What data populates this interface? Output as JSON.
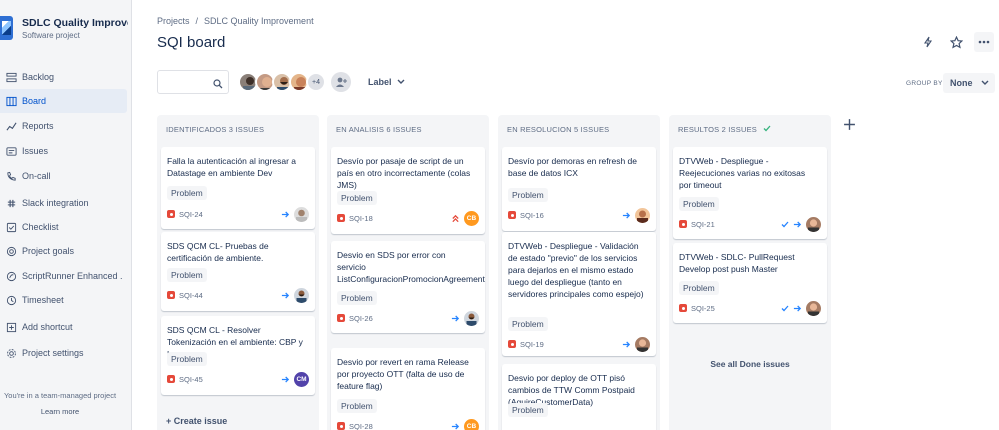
{
  "project": {
    "name": "SDLC Quality Improvem...",
    "type": "Software project"
  },
  "sidebar": {
    "items": [
      {
        "label": "Backlog",
        "icon": "backlog-icon"
      },
      {
        "label": "Board",
        "icon": "board-icon",
        "active": true
      },
      {
        "label": "Reports",
        "icon": "reports-icon"
      },
      {
        "label": "Issues",
        "icon": "issues-icon"
      },
      {
        "label": "On-call",
        "icon": "on-call-icon"
      },
      {
        "label": "Slack integration",
        "icon": "slack-icon"
      },
      {
        "label": "Checklist",
        "icon": "checklist-icon"
      },
      {
        "label": "Project goals",
        "icon": "goals-icon"
      },
      {
        "label": "ScriptRunner Enhanced ...",
        "icon": "scriptrunner-icon"
      },
      {
        "label": "Timesheet",
        "icon": "timesheet-icon"
      },
      {
        "label": "Add shortcut",
        "icon": "add-shortcut-icon"
      },
      {
        "label": "Project settings",
        "icon": "settings-icon"
      }
    ],
    "team_note": "You're in a team-managed project",
    "learn_more": "Learn more"
  },
  "breadcrumb": {
    "projects": "Projects",
    "sep": "/",
    "project": "SDLC Quality Improvement"
  },
  "page_title": "SQI board",
  "toolbar": {
    "avatar_overflow": "+4",
    "label_filter": "Label",
    "group_by": "GROUP BY",
    "group_value": "None"
  },
  "columns": [
    {
      "title": "IDENTIFICADOS 3 ISSUES",
      "create_issue": "+ Create issue",
      "cards": [
        {
          "title": "Falla la autenticación al ingresar a Datastage en ambiente Dev",
          "label": "Problem",
          "key": "SQI-24",
          "priority": "medium",
          "assignee": "gray"
        },
        {
          "title": "SDS QCM CL- Pruebas de certificación de ambiente.",
          "label": "Problem",
          "key": "SQI-44",
          "priority": "medium",
          "assignee": "beard"
        },
        {
          "title": "SDS QCM CL - Resolver Tokenización en el ambiente: CBP y Lyra",
          "label": "Problem",
          "key": "SQI-45",
          "priority": "medium",
          "assignee": "CM"
        }
      ]
    },
    {
      "title": "EN ANALISIS 6 ISSUES",
      "cards": [
        {
          "title": "Desvío por pasaje de script de un país en otro incorrectamente (colas JMS)",
          "label": "Problem",
          "key": "SQI-18",
          "priority": "highest",
          "assignee": "CB"
        },
        {
          "title": "Desvio en SDS por error con servicio ListConfiguracionPromocionAgreement",
          "label": "Problem",
          "key": "SQI-26",
          "priority": "medium",
          "assignee": "beard"
        },
        {
          "title": "Desvio por revert en rama Release por proyecto OTT (falta de uso de feature flag)",
          "label": "Problem",
          "key": "SQI-28",
          "priority": "medium",
          "assignee": "CB"
        }
      ]
    },
    {
      "title": "EN RESOLUCION 5 ISSUES",
      "cards": [
        {
          "title": "Desvío por demoras en refresh de base de datos ICX",
          "label": "Problem",
          "key": "SQI-16",
          "priority": "medium",
          "assignee": "orange"
        },
        {
          "title": "DTVWeb - Despliegue - Validación de estado \"previo\" de los servicios para dejarlos en el mismo estado luego del despliegue (tanto en servidores principales como espejo)",
          "label": "Problem",
          "key": "SQI-19",
          "priority": "medium",
          "assignee": "man"
        },
        {
          "title": "Desvio por deploy de OTT pisó cambios de TTW Comm Postpaid (AquireCustomerData)",
          "label": "Problem",
          "key": "",
          "priority": "",
          "assignee": ""
        }
      ]
    },
    {
      "title": "RESULTOS 2 ISSUES",
      "done": true,
      "see_all": "See all Done issues",
      "cards": [
        {
          "title": "DTVWeb - Despliegue - Reejecuciones varias no exitosas por timeout",
          "label": "Problem",
          "key": "SQI-21",
          "priority": "medium",
          "assignee": "man",
          "done": true
        },
        {
          "title": "DTVWeb - SDLC- PullRequest Develop post push Master",
          "label": "Problem",
          "key": "SQI-25",
          "priority": "medium",
          "assignee": "man",
          "done": true
        }
      ]
    }
  ],
  "colors": {
    "accent": "#0052cc",
    "bug": "#e5493a",
    "highest": "#e5493a",
    "medium_arrow": "#2684ff",
    "done_check": "#36b37e",
    "cb_avatar": "#ff991f",
    "cm_avatar": "#5243aa"
  }
}
